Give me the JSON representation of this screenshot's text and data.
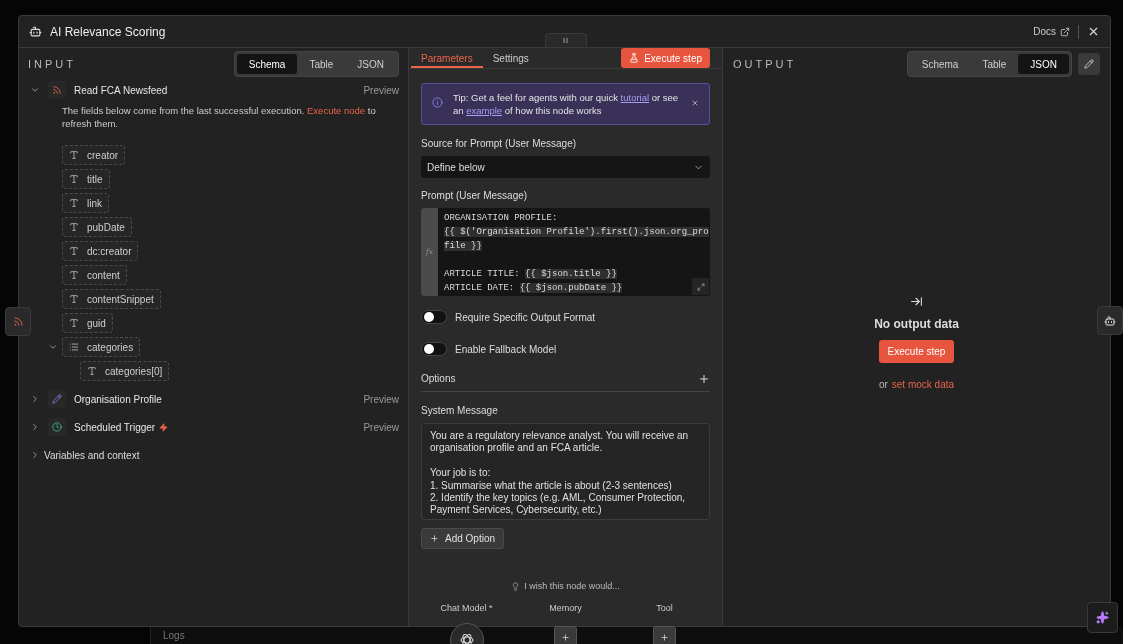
{
  "window": {
    "title": "AI Relevance Scoring",
    "docs": "Docs"
  },
  "input": {
    "heading": "INPUT",
    "view_tabs": [
      {
        "label": "Schema",
        "selected": true
      },
      {
        "label": "Table",
        "selected": false
      },
      {
        "label": "JSON",
        "selected": false
      }
    ],
    "nodes": [
      {
        "name": "Read FCA Newsfeed",
        "kind": "feed",
        "expanded": true,
        "preview": "Preview",
        "trigger": false,
        "note": [
          {
            "kind": "text",
            "text": "The fields below come from the last successful execution. "
          },
          {
            "kind": "link",
            "text": "Execute node"
          },
          {
            "kind": "text",
            "text": " to refresh them."
          }
        ],
        "fields": [
          {
            "kind": "text",
            "name": "creator"
          },
          {
            "kind": "text",
            "name": "title"
          },
          {
            "kind": "text",
            "name": "link"
          },
          {
            "kind": "text",
            "name": "pubDate"
          },
          {
            "kind": "text",
            "name": "dc:creator"
          },
          {
            "kind": "text",
            "name": "content"
          },
          {
            "kind": "text",
            "name": "contentSnippet"
          },
          {
            "kind": "text",
            "name": "guid"
          },
          {
            "kind": "array",
            "name": "categories",
            "expanded": true,
            "children": [
              {
                "kind": "text",
                "name": "categories[0]"
              }
            ]
          }
        ]
      },
      {
        "name": "Organisation Profile",
        "kind": "edit",
        "expanded": false,
        "preview": "Preview",
        "trigger": false
      },
      {
        "name": "Scheduled Trigger",
        "kind": "schedule",
        "expanded": false,
        "preview": "Preview",
        "trigger": true
      }
    ],
    "variables": {
      "label": "Variables and context",
      "expanded": false
    }
  },
  "parameters": {
    "tabs": [
      {
        "label": "Parameters",
        "selected": true
      },
      {
        "label": "Settings",
        "selected": false
      }
    ],
    "execute_button": "Execute step",
    "tip": [
      {
        "kind": "text",
        "text": "Tip: Get a feel for agents with our quick "
      },
      {
        "kind": "link",
        "text": "tutorial"
      },
      {
        "kind": "text",
        "text": " or see an "
      },
      {
        "kind": "link",
        "text": "example"
      },
      {
        "kind": "text",
        "text": " of how this node works"
      }
    ],
    "source": {
      "label": "Source for Prompt (User Message)",
      "value": "Define below"
    },
    "prompt": {
      "label": "Prompt (User Message)",
      "gutter_label": "fx",
      "lines": [
        {
          "segments": [
            {
              "kind": "text",
              "text": "ORGANISATION PROFILE:"
            }
          ]
        },
        {
          "segments": [
            {
              "kind": "expr",
              "text": "{{ $('Organisation Profile').first().json.org_pro"
            }
          ]
        },
        {
          "segments": [
            {
              "kind": "expr",
              "text": "file }}"
            }
          ]
        },
        {
          "gap_before": true,
          "segments": [
            {
              "kind": "text",
              "text": "ARTICLE TITLE: "
            },
            {
              "kind": "expr",
              "text": "{{ $json.title }}"
            }
          ]
        },
        {
          "segments": [
            {
              "kind": "text",
              "text": "ARTICLE DATE: "
            },
            {
              "kind": "expr",
              "text": "{{ $json.pubDate }}"
            }
          ]
        }
      ]
    },
    "toggles": [
      {
        "label": "Require Specific Output Format",
        "on": false
      },
      {
        "label": "Enable Fallback Model",
        "on": false
      }
    ],
    "options": "Options",
    "system_message": {
      "label": "System Message",
      "value": "You are a regulatory relevance analyst. You will receive an organisation profile and an FCA article.\n\nYour job is to:\n1. Summarise what the article is about (2-3 sentences)\n2. Identify the key topics (e.g. AML, Consumer Protection, Payment Services, Cybersecurity, etc.)"
    },
    "add_option": "Add Option",
    "wish": "I wish this node would...",
    "connectors": [
      {
        "label": "Chat Model *",
        "kind": "model"
      },
      {
        "label": "Memory",
        "kind": "add"
      },
      {
        "label": "Tool",
        "kind": "add"
      }
    ]
  },
  "output": {
    "heading": "OUTPUT",
    "view_tabs": [
      {
        "label": "Schema",
        "selected": false
      },
      {
        "label": "Table",
        "selected": false
      },
      {
        "label": "JSON",
        "selected": true
      }
    ],
    "empty_title": "No output data",
    "execute_button": "Execute step",
    "hint": "or",
    "mock_link": "set mock data"
  },
  "background": {
    "logs": "Logs"
  }
}
